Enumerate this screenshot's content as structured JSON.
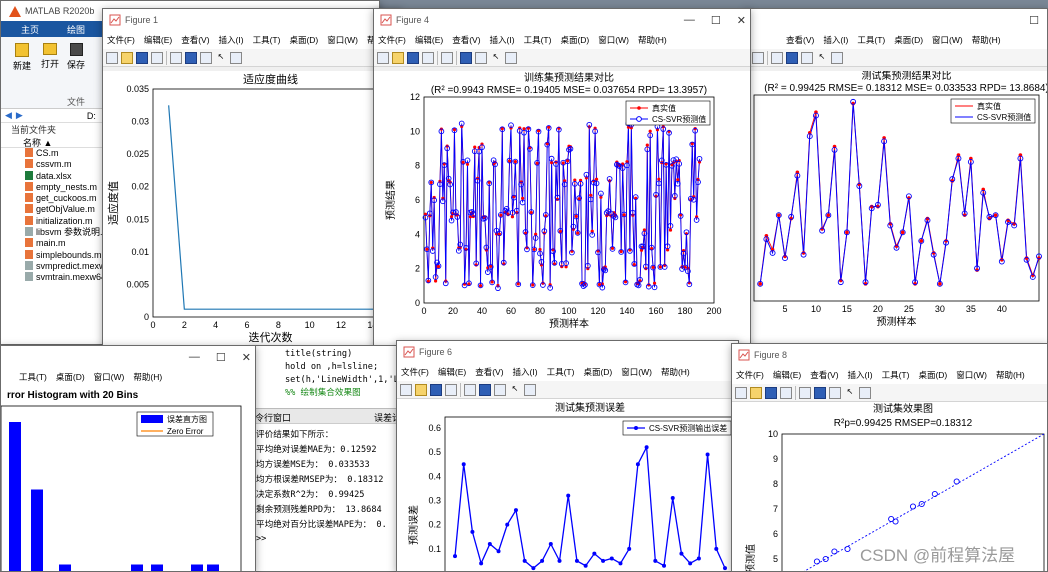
{
  "matlab": {
    "title": "MATLAB R2020b",
    "tab_home": "主页",
    "tab_plots": "绘图",
    "buttons": [
      "新建",
      "打开",
      "保存"
    ],
    "section": "文件",
    "path": "D:",
    "folder_title": "当前文件夹",
    "name_col": "名称 ▲",
    "files": [
      "CS.m",
      "cssvm.m",
      "data.xlsx",
      "empty_nests.m",
      "get_cuckoos.m",
      "getObjValue.m",
      "initialization.m",
      "libsvm 参数说明.t",
      "main.m",
      "simplebounds.m",
      "svmpredict.mexw",
      "svmtrain.mexw64"
    ]
  },
  "figure1": {
    "title": "Figure 1",
    "menus": [
      "文件(F)",
      "编辑(E)",
      "查看(V)",
      "插入(I)",
      "工具(T)",
      "桌面(D)",
      "窗口(W)",
      "帮助(H)"
    ]
  },
  "figure4": {
    "title": "Figure 4",
    "menus": [
      "文件(F)",
      "编辑(E)",
      "查看(V)",
      "插入(I)",
      "工具(T)",
      "桌面(D)",
      "窗口(W)",
      "帮助(H)"
    ]
  },
  "figure_right": {
    "menus": [
      "查看(V)",
      "插入(I)",
      "工具(T)",
      "桌面(D)",
      "窗口(W)",
      "帮助(H)"
    ]
  },
  "figure_left_bottom": {
    "menus": [
      "工具(T)",
      "桌面(D)",
      "窗口(W)",
      "帮助(H)"
    ]
  },
  "figure6": {
    "title": "Figure 6",
    "menus": [
      "文件(F)",
      "编辑(E)",
      "查看(V)",
      "插入(I)",
      "工具(T)",
      "桌面(D)",
      "窗口(W)",
      "帮助(H)"
    ]
  },
  "figure8": {
    "title": "Figure 8",
    "menus": [
      "文件(F)",
      "编辑(E)",
      "查看(V)",
      "插入(I)",
      "工具(T)",
      "桌面(D)",
      "窗口(W)",
      "帮助(H)"
    ]
  },
  "editor": {
    "lines": [
      "title(string)",
      "hold on ,h=lsline;",
      "set(h,'LineWidth',1,'Li",
      "%% 绘制集合效果图"
    ]
  },
  "command_window": {
    "title": "令行窗口",
    "right_label": "误差计",
    "lines": [
      "评价结果如下所示：",
      "平均绝对误差MAE为：0.12592",
      "均方误差MSE为：        0.033533",
      "均方根误差RMSEP为：   0.18312",
      "决定系数R^2为：    0.99425",
      "剩余预测残差RPD为：    13.8684",
      "平均绝对百分比误差MAPE为：     0."
    ],
    "prompt": ">>"
  },
  "watermark": "CSDN @前程算法屋",
  "chart_data": [
    {
      "id": "fitness",
      "type": "line",
      "title": "适应度曲线",
      "xlabel": "迭代次数",
      "ylabel": "适应度值",
      "x": [
        1,
        2,
        3,
        4,
        5,
        6,
        7,
        8,
        9,
        10,
        11,
        12,
        13,
        14,
        15
      ],
      "values": [
        0.0325,
        0.0012,
        0.0012,
        0.0012,
        0.0012,
        0.0012,
        0.0012,
        0.0012,
        0.0012,
        0.0012,
        0.0012,
        0.0012,
        0.0012,
        0.0012,
        0.0012
      ],
      "xticks": [
        0,
        2,
        4,
        6,
        8,
        10,
        12,
        14
      ],
      "yticks": [
        0,
        0.005,
        0.01,
        0.015,
        0.02,
        0.025,
        0.03,
        0.035
      ],
      "xlim": [
        0,
        15
      ],
      "ylim": [
        0,
        0.035
      ],
      "color": "#1f77b4"
    },
    {
      "id": "train",
      "type": "line",
      "title": "训练集预测结果对比",
      "subtitle": "(R² =0.9943 RMSE= 0.19405 MSE= 0.037654 RPD= 13.3957)",
      "xlabel": "预测样本",
      "ylabel": "预测结果",
      "xlim": [
        0,
        200
      ],
      "ylim": [
        0,
        12
      ],
      "xticks": [
        0,
        20,
        40,
        60,
        80,
        100,
        120,
        140,
        160,
        180,
        200
      ],
      "yticks": [
        0,
        2,
        4,
        6,
        8,
        10,
        12
      ],
      "series": [
        {
          "name": "真实值",
          "color": "#ff0000",
          "marker": "dot"
        },
        {
          "name": "CS-SVR预测值",
          "color": "#0000ff",
          "marker": "circle"
        }
      ]
    },
    {
      "id": "test",
      "type": "line",
      "title": "测试集预测结果对比",
      "subtitle": "(R² = 0.99425 RMSE= 0.18312 MSE= 0.033533 RPD= 13.8684)",
      "xlabel": "预测样本",
      "xlim": [
        0,
        46
      ],
      "ylim": [
        0,
        12
      ],
      "xticks": [
        5,
        10,
        15,
        20,
        25,
        30,
        35,
        40
      ],
      "x": [
        1,
        2,
        3,
        4,
        5,
        6,
        7,
        8,
        9,
        10,
        11,
        12,
        13,
        14,
        15,
        16,
        17,
        18,
        19,
        20,
        21,
        22,
        23,
        24,
        25,
        26,
        27,
        28,
        29,
        30,
        31,
        32,
        33,
        34,
        35,
        36,
        37,
        38,
        39,
        40,
        41,
        42,
        43,
        44,
        45,
        46
      ],
      "actual": [
        1,
        3.8,
        3,
        5,
        2.6,
        4.8,
        7.5,
        2.8,
        9.8,
        11,
        4.2,
        5,
        9,
        1.2,
        4,
        11.5,
        6.8,
        1,
        5.5,
        5.5,
        9.5,
        4.5,
        3.2,
        4,
        6,
        1,
        3.5,
        4.8,
        2.8,
        1,
        3.5,
        7,
        8.5,
        5,
        8.3,
        1.8,
        6.5,
        4.8,
        5,
        2.4,
        4.7,
        4.5,
        8.5,
        2.5,
        1.5,
        2.5
      ],
      "pred": [
        1,
        3.6,
        2.8,
        5,
        2.5,
        4.9,
        7.3,
        2.7,
        9.6,
        10.8,
        4.1,
        5,
        8.8,
        1.1,
        4,
        11.6,
        6.7,
        1.1,
        5.4,
        5.6,
        9.3,
        4.4,
        3.1,
        4,
        6.1,
        1.1,
        3.5,
        4.7,
        2.7,
        1,
        3.4,
        7.1,
        8.3,
        5.1,
        8.1,
        1.9,
        6.3,
        4.9,
        5,
        2.3,
        4.6,
        4.4,
        8.3,
        2.4,
        1.4,
        2.6
      ],
      "series": [
        {
          "name": "真实值",
          "color": "#ff0000"
        },
        {
          "name": "CS-SVR预测值",
          "color": "#0000ff"
        }
      ]
    },
    {
      "id": "hist",
      "type": "bar",
      "title": "rror Histogram with 20 Bins",
      "legend": [
        "误差直方图",
        "Zero Error"
      ],
      "values": [
        1.0,
        0.55,
        0.05,
        0.05,
        0.05,
        0.05,
        0.05
      ]
    },
    {
      "id": "testerr",
      "type": "line",
      "title": "测试集预测误差",
      "ylabel": "预测误差",
      "legend": "CS-SVR预测输出误差",
      "ylim": [
        0,
        0.6
      ],
      "yticks": [
        0.1,
        0.2,
        0.3,
        0.4,
        0.5,
        0.6
      ],
      "values": [
        0.07,
        0.45,
        0.17,
        0.04,
        0.12,
        0.09,
        0.2,
        0.26,
        0.05,
        0.02,
        0.05,
        0.12,
        0.05,
        0.32,
        0.05,
        0.03,
        0.08,
        0.05,
        0.06,
        0.04,
        0.1,
        0.45,
        0.52,
        0.05,
        0.03,
        0.31,
        0.08,
        0.04,
        0.06,
        0.49,
        0.1,
        0.02
      ]
    },
    {
      "id": "scatter",
      "type": "scatter",
      "title": "测试集效果图",
      "subtitle": "R²p=0.99425  RMSEP=0.18312",
      "ylabel": "预测值",
      "ylim": [
        4,
        10
      ],
      "yticks": [
        5,
        6,
        7,
        8,
        9,
        10
      ],
      "x": [
        4.5,
        4.8,
        5.0,
        5.2,
        5.5,
        6.5,
        6.6,
        7.0,
        7.2,
        7.5,
        8.0
      ],
      "y": [
        4.4,
        4.9,
        5.0,
        5.3,
        5.4,
        6.6,
        6.5,
        7.1,
        7.2,
        7.6,
        8.1
      ]
    }
  ]
}
